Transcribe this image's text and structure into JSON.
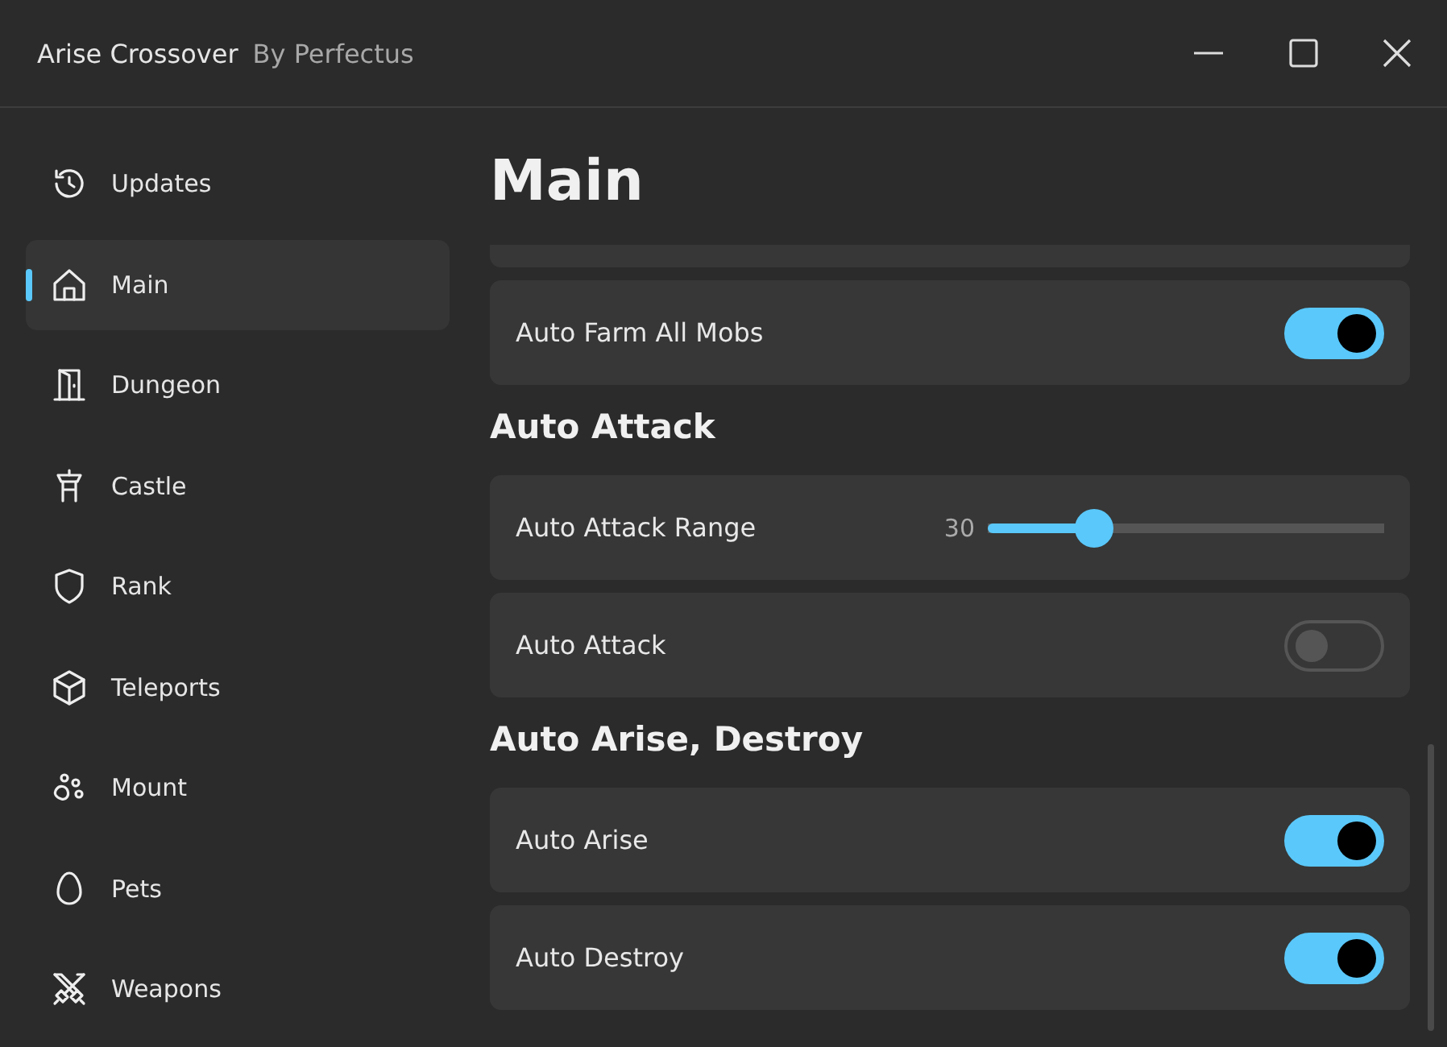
{
  "window": {
    "title": "Arise Crossover",
    "subtitle": "By Perfectus"
  },
  "sidebar": {
    "items": [
      {
        "label": "Updates",
        "selected": false
      },
      {
        "label": "Main",
        "selected": true
      },
      {
        "label": "Dungeon",
        "selected": false
      },
      {
        "label": "Castle",
        "selected": false
      },
      {
        "label": "Rank",
        "selected": false
      },
      {
        "label": "Teleports",
        "selected": false
      },
      {
        "label": "Mount",
        "selected": false
      },
      {
        "label": "Pets",
        "selected": false
      },
      {
        "label": "Weapons",
        "selected": false
      }
    ]
  },
  "page": {
    "title": "Main",
    "sections": [
      {
        "items": [
          {
            "kind": "toggle",
            "label": "Auto Farm All Mobs",
            "on": true
          }
        ]
      },
      {
        "title": "Auto Attack",
        "items": [
          {
            "kind": "slider",
            "label": "Auto Attack Range",
            "reading": "30",
            "level": 0.27
          },
          {
            "kind": "toggle",
            "label": "Auto Attack",
            "on": false
          }
        ]
      },
      {
        "title": "Auto Arise, Destroy",
        "items": [
          {
            "kind": "toggle",
            "label": "Auto Arise",
            "on": true
          },
          {
            "kind": "toggle",
            "label": "Auto Destroy",
            "on": true
          }
        ]
      }
    ]
  }
}
